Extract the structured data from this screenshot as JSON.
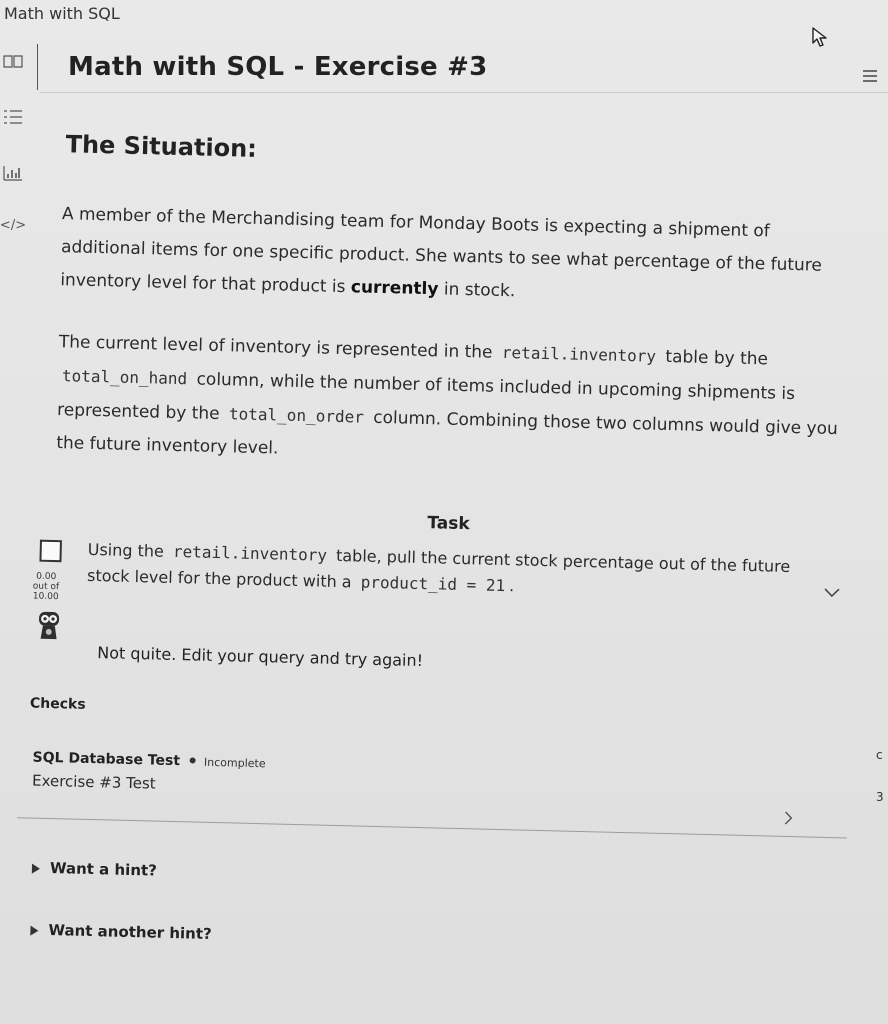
{
  "app": {
    "title": "Math with SQL"
  },
  "header": {
    "title": "Math with SQL - Exercise #3"
  },
  "rail": {
    "icons": [
      "book-icon",
      "list-icon",
      "chart-icon",
      "code-icon"
    ],
    "code_label": "</>"
  },
  "situation": {
    "heading": "The Situation:",
    "p1_text_a": "A member of the Merchandising team for Monday Boots is expecting a shipment of additional items for one specific product. She wants to see what percentage of the future inventory level for that product is ",
    "p1_bold": "currently",
    "p1_text_b": " in stock.",
    "p2_text_a": "The current level of inventory is represented in the ",
    "p2_code1": "retail.inventory",
    "p2_text_b": " table by the ",
    "p2_code2": "total_on_hand",
    "p2_text_c": " column, while the number of items included in upcoming shipments is represented by the ",
    "p2_code3": "total_on_order",
    "p2_text_d": " column. Combining those two columns would give you the future inventory level."
  },
  "task": {
    "heading": "Task",
    "text_a": "Using the ",
    "code1": "retail.inventory",
    "text_b": " table, pull the current stock percentage out of the future stock level for the product with a ",
    "code2": "product_id = 21",
    "text_c": ".",
    "score_value": "0.00",
    "score_out_of": "out of",
    "score_total": "10.00",
    "feedback": "Not quite. Edit your query and try again!"
  },
  "checks": {
    "label": "Checks",
    "items": [
      {
        "title": "SQL Database Test",
        "status": "Incomplete",
        "subtitle": "Exercise #3 Test"
      }
    ]
  },
  "hints": {
    "hint1": "Want a hint?",
    "hint2": "Want another hint?"
  },
  "right_edge": {
    "char1": "c",
    "char2": "3"
  }
}
